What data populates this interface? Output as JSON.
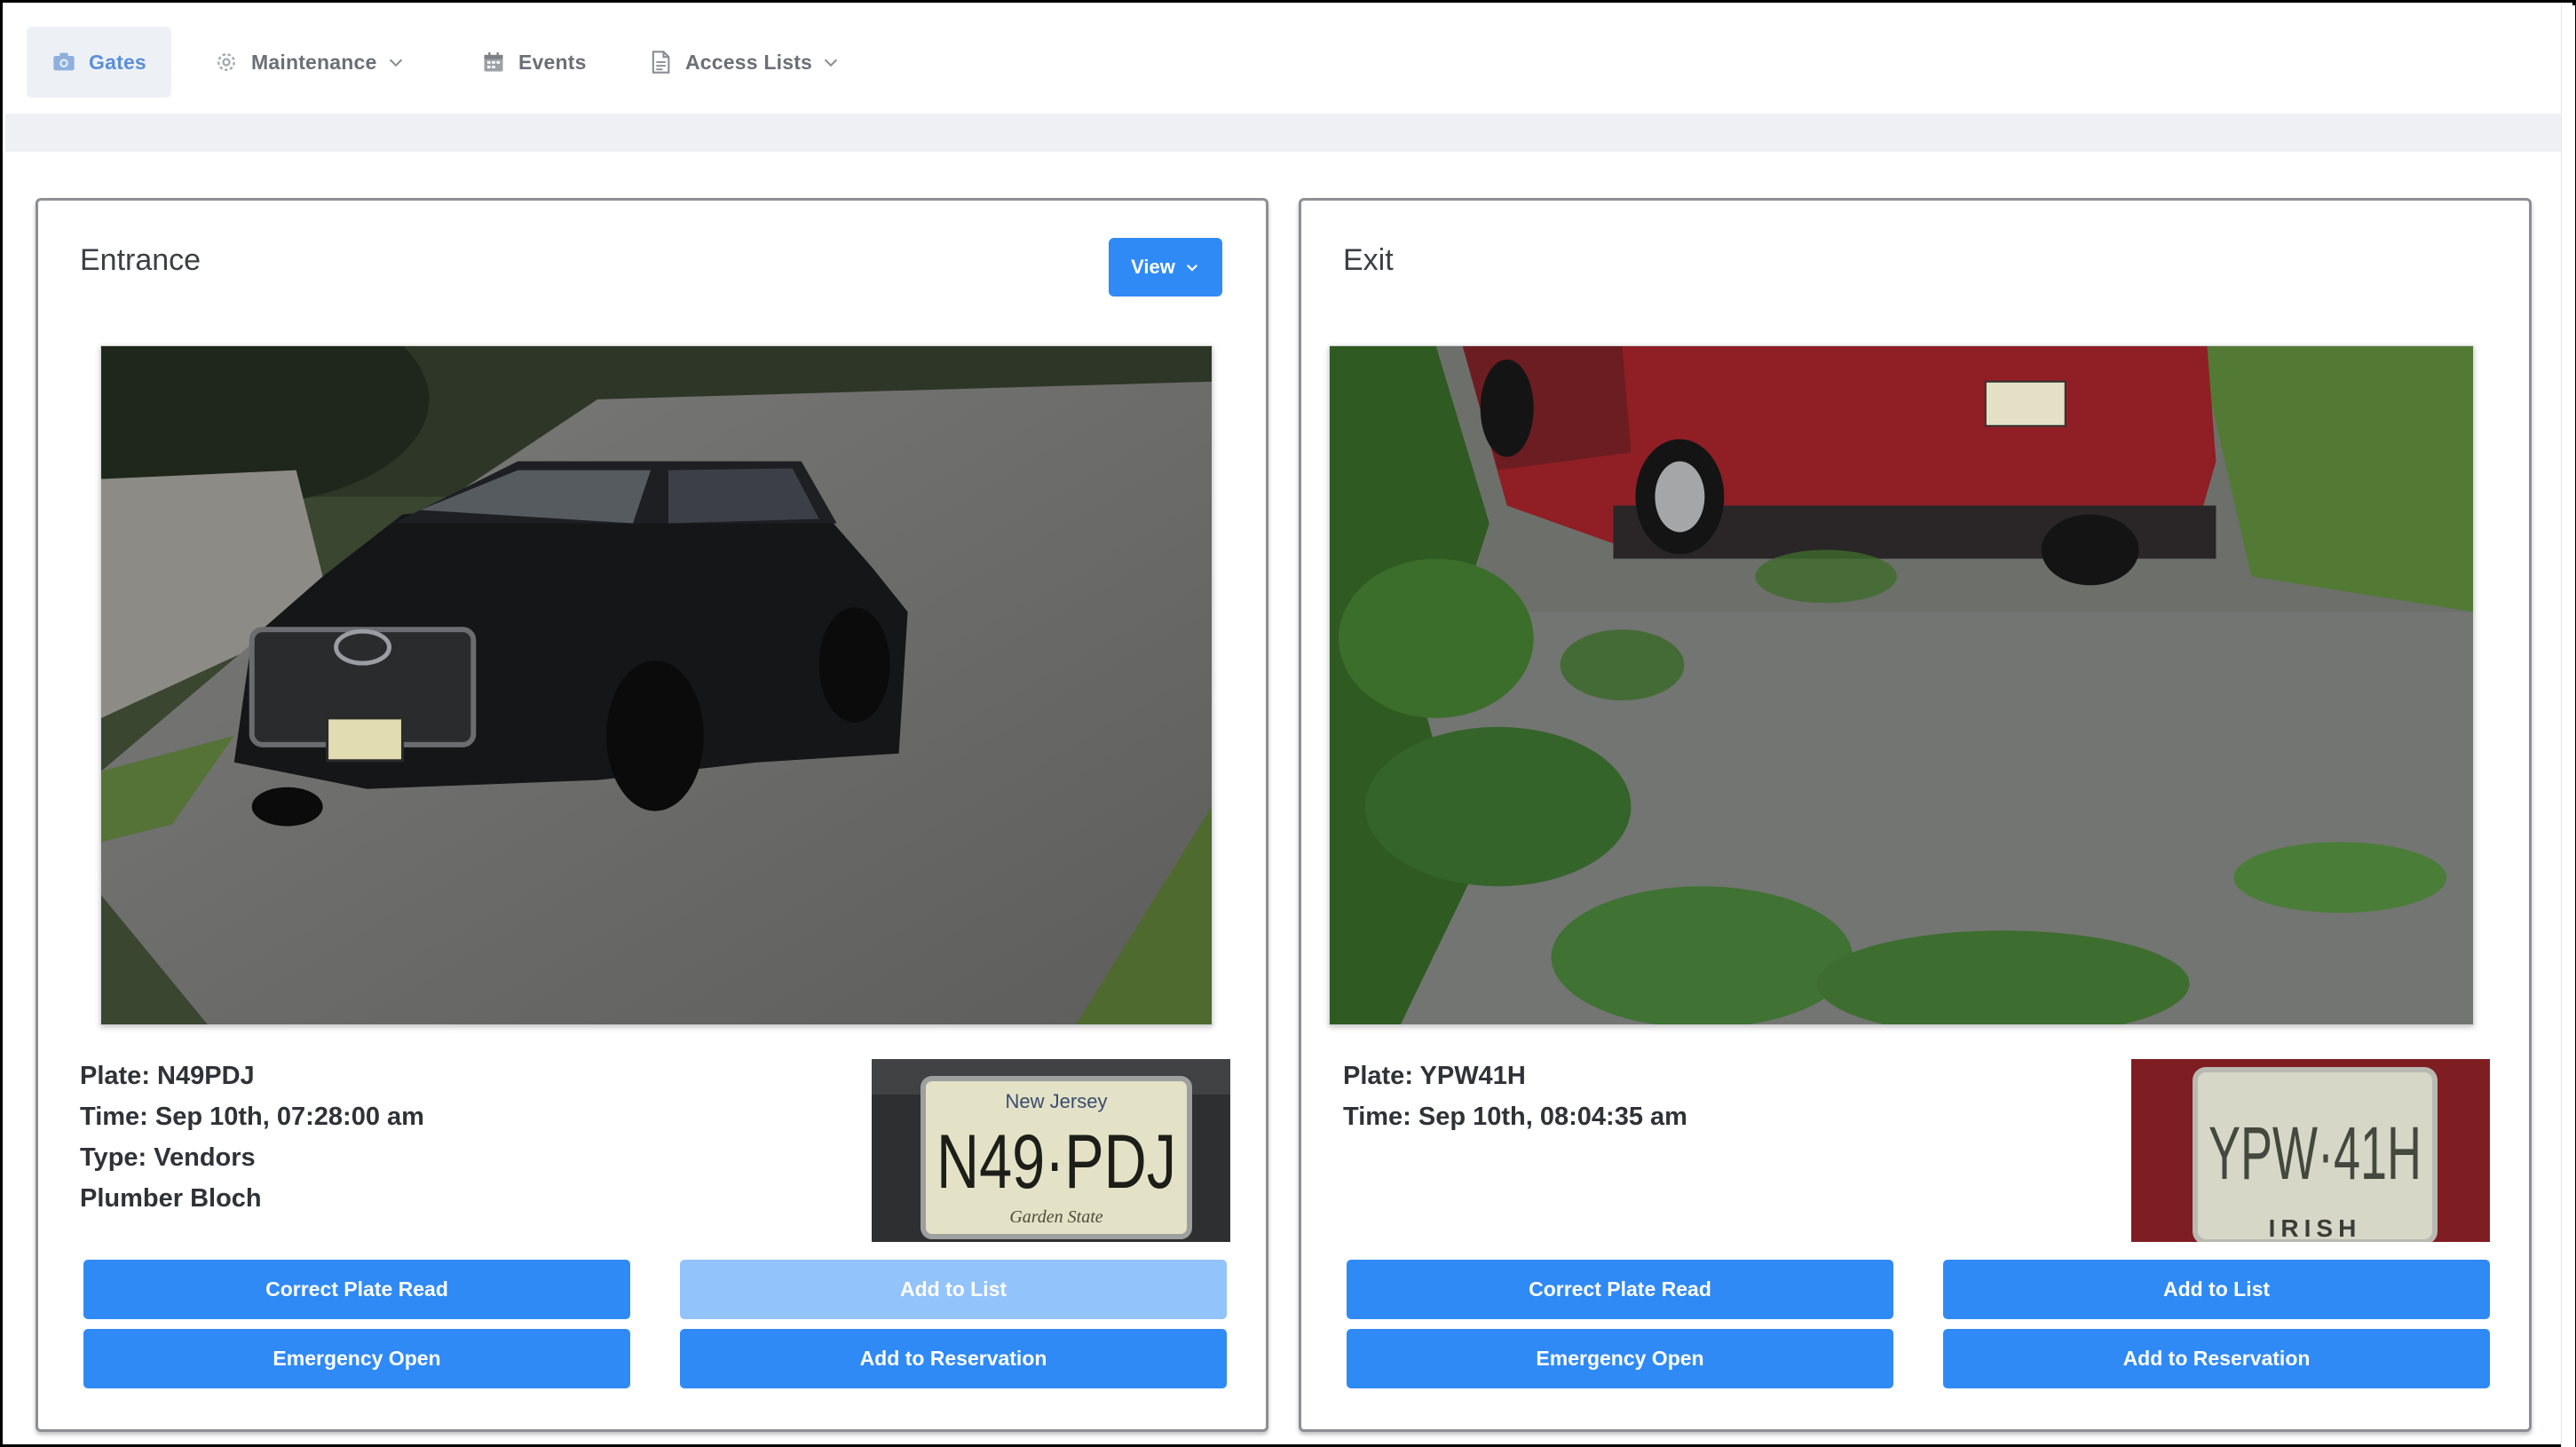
{
  "nav": {
    "items": [
      {
        "label": "Gates",
        "icon": "camera-icon",
        "active": true
      },
      {
        "label": "Maintenance",
        "icon": "gear-icon",
        "dropdown": true
      },
      {
        "label": "Events",
        "icon": "calendar-icon"
      },
      {
        "label": "Access Lists",
        "icon": "document-icon",
        "dropdown": true
      }
    ]
  },
  "entrance": {
    "title": "Entrance",
    "view_label": "View",
    "plate_line": "Plate: N49PDJ",
    "time_line": "Time: Sep 10th, 07:28:00 am",
    "type_line": "Type: Vendors",
    "note_line": "Plumber Bloch",
    "plate_crop_text": "N49·PDJ",
    "plate_crop_state": "New Jersey",
    "plate_crop_motto": "Garden State",
    "buttons": {
      "correct": "Correct Plate Read",
      "add_list": "Add to List",
      "emergency": "Emergency Open",
      "reservation": "Add to Reservation"
    }
  },
  "exit": {
    "title": "Exit",
    "plate_line": "Plate: YPW41H",
    "time_line": "Time: Sep 10th, 08:04:35 am",
    "plate_crop_text": "YPW·41H",
    "plate_crop_bottom": "IRISH",
    "buttons": {
      "correct": "Correct Plate Read",
      "add_list": "Add to List",
      "emergency": "Emergency Open",
      "reservation": "Add to Reservation"
    }
  },
  "colors": {
    "primary": "#2f8af5",
    "primary_disabled": "#93c3fb",
    "nav_active_text": "#5b8fd6",
    "nav_text": "#6b6f76"
  }
}
